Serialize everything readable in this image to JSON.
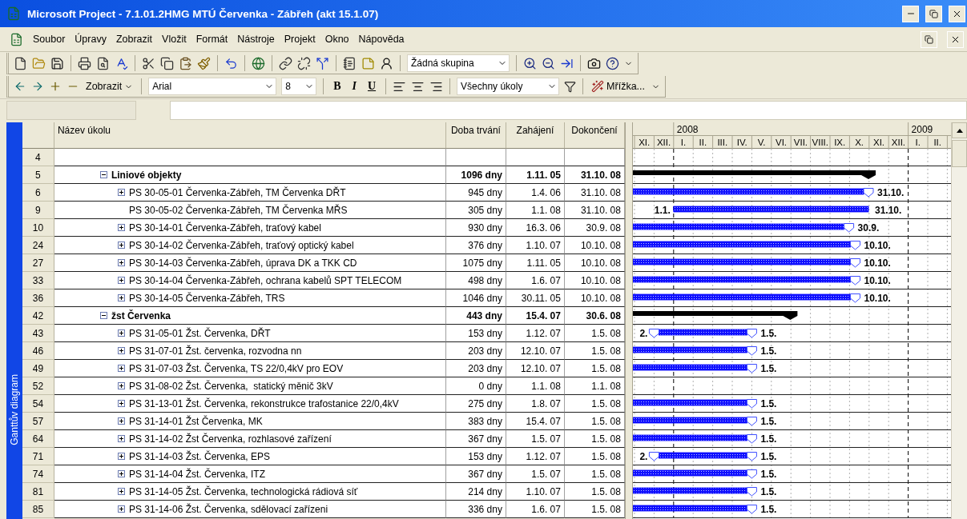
{
  "window": {
    "title": "Microsoft Project - 7.1.01.2HMG MTÚ Červenka - Zábřeh (akt 15.1.07)"
  },
  "menu": [
    "Soubor",
    "Úpravy",
    "Zobrazit",
    "Vložit",
    "Formát",
    "Nástroje",
    "Projekt",
    "Okno",
    "Nápověda"
  ],
  "standard_toolbar": {
    "group_select": "Žádná skupina"
  },
  "formatting_toolbar": {
    "view_button": "Zobrazit",
    "font": "Arial",
    "font_size": "8",
    "bold": "B",
    "italic": "I",
    "underline": "U",
    "filter_select": "Všechny úkoly",
    "wizard_button": "Mřížka..."
  },
  "view_bar": {
    "label": "Ganttův diagram"
  },
  "timescale": {
    "months": [
      {
        "label": "XI."
      },
      {
        "label": "XII."
      },
      {
        "label": "I.",
        "year": "2008"
      },
      {
        "label": "II."
      },
      {
        "label": "III."
      },
      {
        "label": "IV."
      },
      {
        "label": "V."
      },
      {
        "label": "VI."
      },
      {
        "label": "VII."
      },
      {
        "label": "VIII."
      },
      {
        "label": "IX."
      },
      {
        "label": "X."
      },
      {
        "label": "XI."
      },
      {
        "label": "XII."
      },
      {
        "label": "I.",
        "year": "2009"
      },
      {
        "label": "II."
      }
    ]
  },
  "table": {
    "columns": [
      "Název úkolu",
      "Doba trvání",
      "Zahájení",
      "Dokončení"
    ],
    "rows": [
      {
        "id": "4"
      },
      {
        "id": "5",
        "kind": "summary",
        "expanded": true,
        "name": "Liniové objekty",
        "duration": "1096 dny",
        "start": "1.11. 05",
        "finish": "31.10. 08",
        "bar": {
          "kind": "summary"
        },
        "children": [
          {
            "id": "6",
            "kind": "task",
            "expanded": false,
            "name": "PS 30-05-01 Červenka-Zábřeh, TM Červenka DŘT",
            "duration": "945 dny",
            "start": "1.4. 06",
            "finish": "31.10. 08",
            "bar": {
              "kind": "rollup",
              "end_label": "31.10."
            }
          },
          {
            "id": "9",
            "kind": "task",
            "name": "PS 30-05-02 Červenka-Zábřeh, TM Červenka MŘS",
            "duration": "305 dny",
            "start": "1.1. 08",
            "finish": "31.10. 08",
            "bar": {
              "kind": "task",
              "start_label": "1.1.",
              "end_label": "31.10."
            }
          },
          {
            "id": "10",
            "kind": "task",
            "expanded": false,
            "name": "PS 30-14-01 Červenka-Zábřeh, traťový kabel",
            "duration": "930 dny",
            "start": "16.3. 06",
            "finish": "30.9. 08",
            "bar": {
              "kind": "rollup",
              "end_label": "30.9."
            }
          },
          {
            "id": "24",
            "kind": "task",
            "expanded": false,
            "name": "PS 30-14-02 Červenka-Zábřeh, traťový optický kabel",
            "duration": "376 dny",
            "start": "1.10. 07",
            "finish": "10.10. 08",
            "bar": {
              "kind": "rollup",
              "end_label": "10.10."
            }
          },
          {
            "id": "27",
            "kind": "task",
            "expanded": false,
            "name": "PS 30-14-03 Červenka-Zábřeh, úprava DK a TKK CD",
            "duration": "1075 dny",
            "start": "1.11. 05",
            "finish": "10.10. 08",
            "bar": {
              "kind": "rollup",
              "end_label": "10.10."
            }
          },
          {
            "id": "33",
            "kind": "task",
            "expanded": false,
            "name": "PS 30-14-04 Červenka-Zábřeh, ochrana kabelů SPT TELECOM",
            "duration": "498 dny",
            "start": "1.6. 07",
            "finish": "10.10. 08",
            "bar": {
              "kind": "rollup",
              "end_label": "10.10."
            }
          },
          {
            "id": "36",
            "kind": "task",
            "expanded": false,
            "name": "PS 30-14-05 Červenka-Zábřeh, TRS",
            "duration": "1046 dny",
            "start": "30.11. 05",
            "finish": "10.10. 08",
            "bar": {
              "kind": "rollup",
              "end_label": "10.10."
            }
          }
        ]
      },
      {
        "id": "42",
        "kind": "summary",
        "expanded": true,
        "name": "žst Červenka",
        "duration": "443 dny",
        "start": "15.4. 07",
        "finish": "30.6. 08",
        "bar": {
          "kind": "summary"
        },
        "children": [
          {
            "id": "43",
            "kind": "task",
            "expanded": false,
            "name": "PS 31-05-01 Žst. Červenka, DŘT",
            "duration": "153 dny",
            "start": "1.12. 07",
            "finish": "1.5. 08",
            "bar": {
              "kind": "rollup",
              "start_label": "2.",
              "end_label": "1.5."
            }
          },
          {
            "id": "46",
            "kind": "task",
            "expanded": false,
            "name": "PS 31-07-01 Žst. červenka, rozvodna nn",
            "duration": "203 dny",
            "start": "12.10. 07",
            "finish": "1.5. 08",
            "bar": {
              "kind": "rollup",
              "end_label": "1.5."
            }
          },
          {
            "id": "49",
            "kind": "task",
            "expanded": false,
            "name": "PS 31-07-03 Žst. Červenka, TS 22/0,4kV pro EOV",
            "duration": "203 dny",
            "start": "12.10. 07",
            "finish": "1.5. 08",
            "bar": {
              "kind": "rollup",
              "end_label": "1.5."
            }
          },
          {
            "id": "52",
            "kind": "task",
            "expanded": false,
            "name": "PS 31-08-02 Žst. Červenka,  statický měnič 3kV",
            "duration": "0 dny",
            "start": "1.1. 08",
            "finish": "1.1. 08"
          },
          {
            "id": "54",
            "kind": "task",
            "expanded": false,
            "name": "PS 31-13-01 Žst. Červenka, rekonstrukce trafostanice 22/0,4kV",
            "duration": "275 dny",
            "start": "1.8. 07",
            "finish": "1.5. 08",
            "bar": {
              "kind": "rollup",
              "end_label": "1.5."
            }
          },
          {
            "id": "57",
            "kind": "task",
            "expanded": false,
            "name": "PS 31-14-01 Žst Červenka, MK",
            "duration": "383 dny",
            "start": "15.4. 07",
            "finish": "1.5. 08",
            "bar": {
              "kind": "rollup",
              "end_label": "1.5."
            }
          },
          {
            "id": "64",
            "kind": "task",
            "expanded": false,
            "name": "PS 31-14-02 Žst Červenka, rozhlasové zařízení",
            "duration": "367 dny",
            "start": "1.5. 07",
            "finish": "1.5. 08",
            "bar": {
              "kind": "rollup",
              "end_label": "1.5."
            }
          },
          {
            "id": "71",
            "kind": "task",
            "expanded": false,
            "name": "PS 31-14-03 Žst. Červenka, EPS",
            "duration": "153 dny",
            "start": "1.12. 07",
            "finish": "1.5. 08",
            "bar": {
              "kind": "rollup",
              "start_label": "2.",
              "end_label": "1.5."
            }
          },
          {
            "id": "74",
            "kind": "task",
            "expanded": false,
            "name": "PS 31-14-04 Žst. Červenka, ITZ",
            "duration": "367 dny",
            "start": "1.5. 07",
            "finish": "1.5. 08",
            "bar": {
              "kind": "rollup",
              "end_label": "1.5."
            }
          },
          {
            "id": "81",
            "kind": "task",
            "expanded": false,
            "name": "PS 31-14-05 Žst. Červenka, technologická rádiová síť",
            "duration": "214 dny",
            "start": "1.10. 07",
            "finish": "1.5. 08",
            "bar": {
              "kind": "rollup",
              "end_label": "1.5."
            }
          },
          {
            "id": "85",
            "kind": "task",
            "expanded": false,
            "name": "PS 31-14-06 Žst. Červenka, sdělovací zařízeni",
            "duration": "336 dny",
            "start": "1.6. 07",
            "finish": "1.5. 08",
            "bar": {
              "kind": "rollup",
              "end_label": "1.5."
            }
          }
        ]
      }
    ]
  }
}
